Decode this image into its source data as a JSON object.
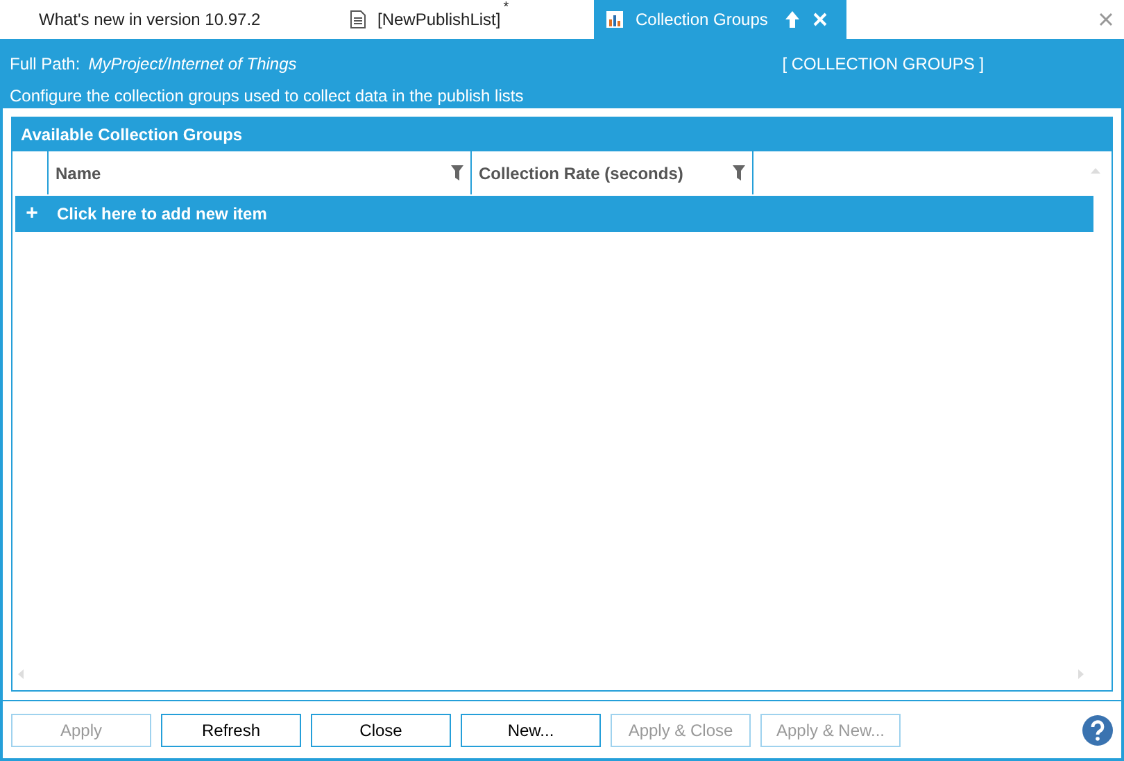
{
  "tabs": [
    {
      "label": "What's new in version 10.97.2",
      "kind": "plain",
      "modified": false,
      "selected": false
    },
    {
      "label": "[NewPublishList]",
      "kind": "document",
      "modified": true,
      "selected": false
    },
    {
      "label": "Collection Groups",
      "kind": "chart",
      "modified": false,
      "selected": true
    }
  ],
  "modified_mark": "*",
  "header": {
    "path_label": "Full Path:",
    "path": "MyProject/Internet of Things",
    "section": "[ COLLECTION GROUPS ]",
    "description": "Configure the collection groups used to collect data in the publish lists"
  },
  "panel": {
    "title": "Available Collection Groups",
    "columns": [
      "Name",
      "Collection Rate (seconds)"
    ],
    "add_row": {
      "icon": "+",
      "label": "Click here to add new item"
    }
  },
  "buttons": [
    {
      "label": "Apply",
      "disabled": true
    },
    {
      "label": "Refresh",
      "disabled": false
    },
    {
      "label": "Close",
      "disabled": false
    },
    {
      "label": "New...",
      "disabled": false
    },
    {
      "label": "Apply & Close",
      "disabled": true
    },
    {
      "label": "Apply & New...",
      "disabled": true
    }
  ]
}
